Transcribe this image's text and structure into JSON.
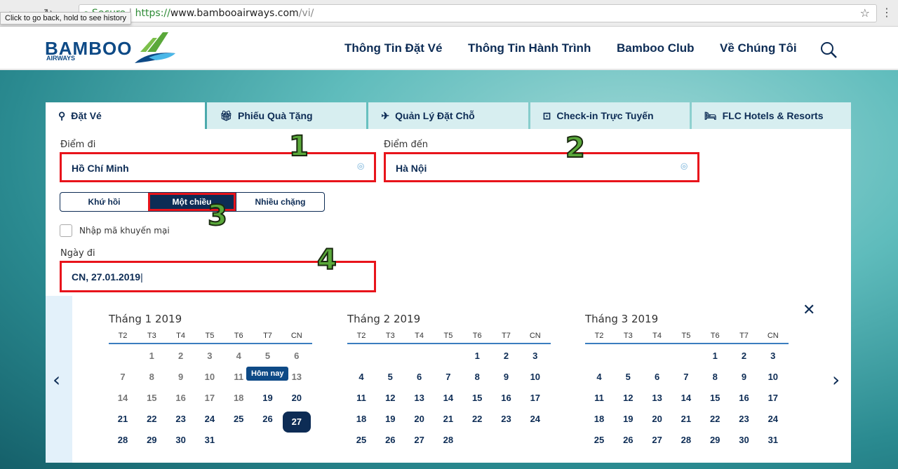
{
  "browser": {
    "url_scheme": "https://",
    "url_host": "www.bamboo airways.com",
    "url_display_host": "www.bambooairways.com",
    "url_path": "/vi/",
    "secure_label": "Secure",
    "tooltip": "Click to go back, hold to see history"
  },
  "header": {
    "logo": "BAMBOO",
    "logo_sub": "AIRWAYS",
    "nav": [
      "Thông Tin Đặt Vé",
      "Thông Tin Hành Trình",
      "Bamboo Club",
      "Về Chúng Tôi"
    ]
  },
  "tabs": [
    {
      "label": "Đặt Vé",
      "icon": "search-icon"
    },
    {
      "label": "Phiếu Quà Tặng",
      "icon": "gift-icon"
    },
    {
      "label": "Quản Lý Đặt Chỗ",
      "icon": "plane-icon"
    },
    {
      "label": "Check-in Trực Tuyến",
      "icon": "checkin-icon"
    },
    {
      "label": "FLC Hotels & Resorts",
      "icon": "bed-icon"
    }
  ],
  "form": {
    "from_label": "Điểm đi",
    "from_value": "Hồ Chí Minh",
    "to_label": "Điểm đến",
    "to_value": "Hà Nội",
    "trip_types": [
      "Khứ hồi",
      "Một chiều",
      "Nhiều chặng"
    ],
    "selected_trip": "Một chiều",
    "promo_label": "Nhập mã khuyến mại",
    "date_label": "Ngày đi",
    "date_value": "CN, 27.01.2019"
  },
  "annotations": [
    "1",
    "2",
    "3",
    "4"
  ],
  "calendar": {
    "weekdays": [
      "T2",
      "T3",
      "T4",
      "T5",
      "T6",
      "T7",
      "CN"
    ],
    "today_label": "Hôm nay",
    "selected": "27",
    "months": [
      {
        "title": "Tháng 1 2019",
        "past_until": 18,
        "weeks": [
          [
            "",
            "1",
            "2",
            "3",
            "4",
            "5",
            "6"
          ],
          [
            "7",
            "8",
            "9",
            "10",
            "11",
            "12",
            "13"
          ],
          [
            "14",
            "15",
            "16",
            "17",
            "18",
            "19",
            "20"
          ],
          [
            "21",
            "22",
            "23",
            "24",
            "25",
            "26",
            "27"
          ],
          [
            "28",
            "29",
            "30",
            "31",
            "",
            "",
            ""
          ]
        ]
      },
      {
        "title": "Tháng 2 2019",
        "past_until": 0,
        "weeks": [
          [
            "",
            "",
            "",
            "",
            "1",
            "2",
            "3"
          ],
          [
            "4",
            "5",
            "6",
            "7",
            "8",
            "9",
            "10"
          ],
          [
            "11",
            "12",
            "13",
            "14",
            "15",
            "16",
            "17"
          ],
          [
            "18",
            "19",
            "20",
            "21",
            "22",
            "23",
            "24"
          ],
          [
            "25",
            "26",
            "27",
            "28",
            "",
            "",
            ""
          ]
        ]
      },
      {
        "title": "Tháng 3 2019",
        "past_until": 0,
        "weeks": [
          [
            "",
            "",
            "",
            "",
            "1",
            "2",
            "3"
          ],
          [
            "4",
            "5",
            "6",
            "7",
            "8",
            "9",
            "10"
          ],
          [
            "11",
            "12",
            "13",
            "14",
            "15",
            "16",
            "17"
          ],
          [
            "18",
            "19",
            "20",
            "21",
            "22",
            "23",
            "24"
          ],
          [
            "25",
            "26",
            "27",
            "28",
            "29",
            "30",
            "31"
          ]
        ]
      }
    ]
  },
  "colors": {
    "navy": "#0d2c55",
    "highlight": "#e8141b",
    "annotation": "#5aa83a"
  }
}
